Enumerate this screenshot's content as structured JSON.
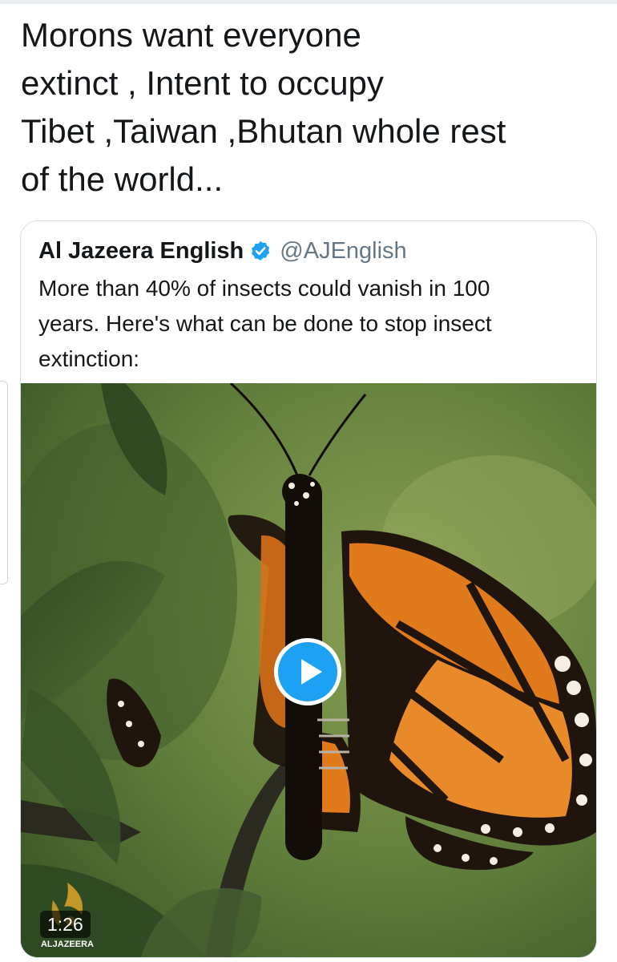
{
  "tweet": {
    "text": "Morons want everyone\nextinct , Intent to occupy\nTibet ,Taiwan ,Bhutan whole rest\nof the world..."
  },
  "quoted_tweet": {
    "author_name": "Al Jazeera English",
    "verified": true,
    "handle": "@AJEnglish",
    "text": "More than 40% of insects could vanish in 100\nyears. Here's what can be done to stop insect\nextinction:",
    "media": {
      "type": "video",
      "duration": "1:26",
      "watermark_text": "ALJAZEERA",
      "play_icon": "play-icon"
    }
  },
  "colors": {
    "text_primary": "#14171a",
    "text_secondary": "#657786",
    "verified_blue": "#1da1f2",
    "card_border": "#d6dde3",
    "butterfly_orange": "#e07a1c",
    "logo_gold": "#d4a12a"
  }
}
